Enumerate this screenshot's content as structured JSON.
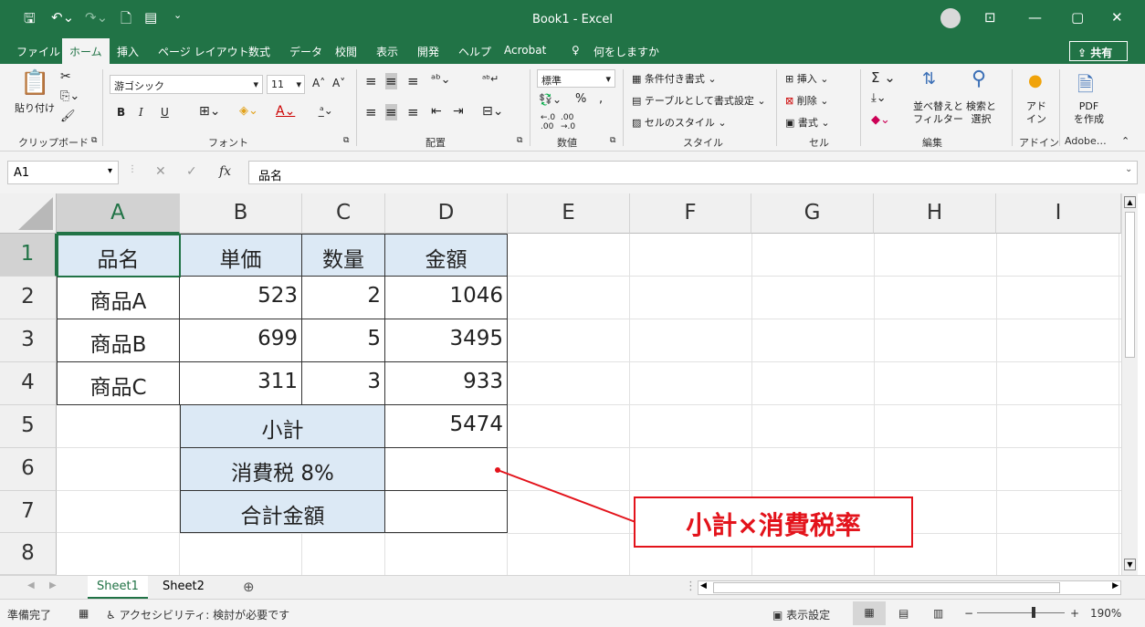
{
  "titlebar": {
    "title": "Book1  -  Excel",
    "save_icon": "save-icon",
    "undo_icon": "undo-icon",
    "redo_icon": "redo-icon",
    "minimize": "—",
    "restore": "▢",
    "close": "✕"
  },
  "menu": {
    "items": [
      "ファイル",
      "ホーム",
      "挿入",
      "ページ レイアウト",
      "数式",
      "データ",
      "校閲",
      "表示",
      "開発",
      "ヘルプ",
      "Acrobat",
      "何をしますか"
    ],
    "share": "共有"
  },
  "ribbon": {
    "clipboard": {
      "paste": "貼り付け",
      "label": "クリップボード"
    },
    "font": {
      "name": "游ゴシック",
      "size": "11",
      "bold": "B",
      "italic": "I",
      "underline": "U",
      "label": "フォント"
    },
    "alignment": {
      "label": "配置"
    },
    "number": {
      "format": "標準",
      "label": "数値"
    },
    "styles": {
      "conditional": "条件付き書式",
      "table": "テーブルとして書式設定",
      "cell": "セルのスタイル",
      "label": "スタイル"
    },
    "cells": {
      "insert": "挿入",
      "delete": "削除",
      "format": "書式",
      "label": "セル"
    },
    "editing": {
      "sort": "並べ替えと\nフィルター",
      "find": "検索と\n選択",
      "label": "編集"
    },
    "addins": {
      "addin": "アド\nイン",
      "label": "アドイン"
    },
    "adobe": {
      "pdf": "PDF\nを作成",
      "label": "Adobe…"
    }
  },
  "formula_bar": {
    "name_box": "A1",
    "fx": "fx",
    "content": "品名"
  },
  "columns": [
    "A",
    "B",
    "C",
    "D",
    "E",
    "F",
    "G",
    "H",
    "I"
  ],
  "rows": [
    "1",
    "2",
    "3",
    "4",
    "5",
    "6",
    "7",
    "8"
  ],
  "table": {
    "headers": [
      "品名",
      "単価",
      "数量",
      "金額"
    ],
    "items": [
      {
        "name": "商品A",
        "price": "523",
        "qty": "2",
        "amount": "1046"
      },
      {
        "name": "商品B",
        "price": "699",
        "qty": "5",
        "amount": "3495"
      },
      {
        "name": "商品C",
        "price": "311",
        "qty": "3",
        "amount": "933"
      }
    ],
    "subtotal_label": "小計",
    "subtotal_value": "5474",
    "tax_label": "消費税 8%",
    "total_label": "合計金額"
  },
  "annotation": "小計×消費税率",
  "sheets": [
    "Sheet1",
    "Sheet2"
  ],
  "status": {
    "ready": "準備完了",
    "accessibility": "アクセシビリティ: 検討が必要です",
    "display_settings": "表示設定",
    "zoom": "190%"
  },
  "colors": {
    "excel_green": "#217346",
    "header_fill": "#dce9f5",
    "callout": "#e3131b"
  }
}
